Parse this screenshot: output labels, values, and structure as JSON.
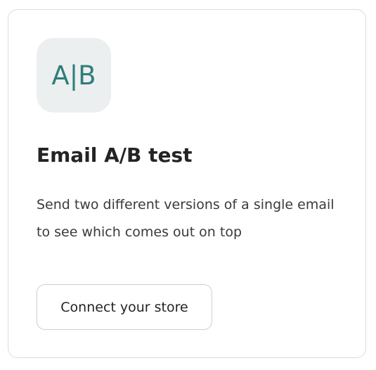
{
  "card": {
    "icon_text": "A|B",
    "title": "Email A/B test",
    "description": "Send two different versions of a single email to see which comes out on top",
    "button_label": "Connect your store"
  },
  "colors": {
    "icon_tile_background": "#ecefef",
    "icon_text": "#2f7d7b",
    "title": "#242424",
    "card_border": "#dcdcdc"
  }
}
